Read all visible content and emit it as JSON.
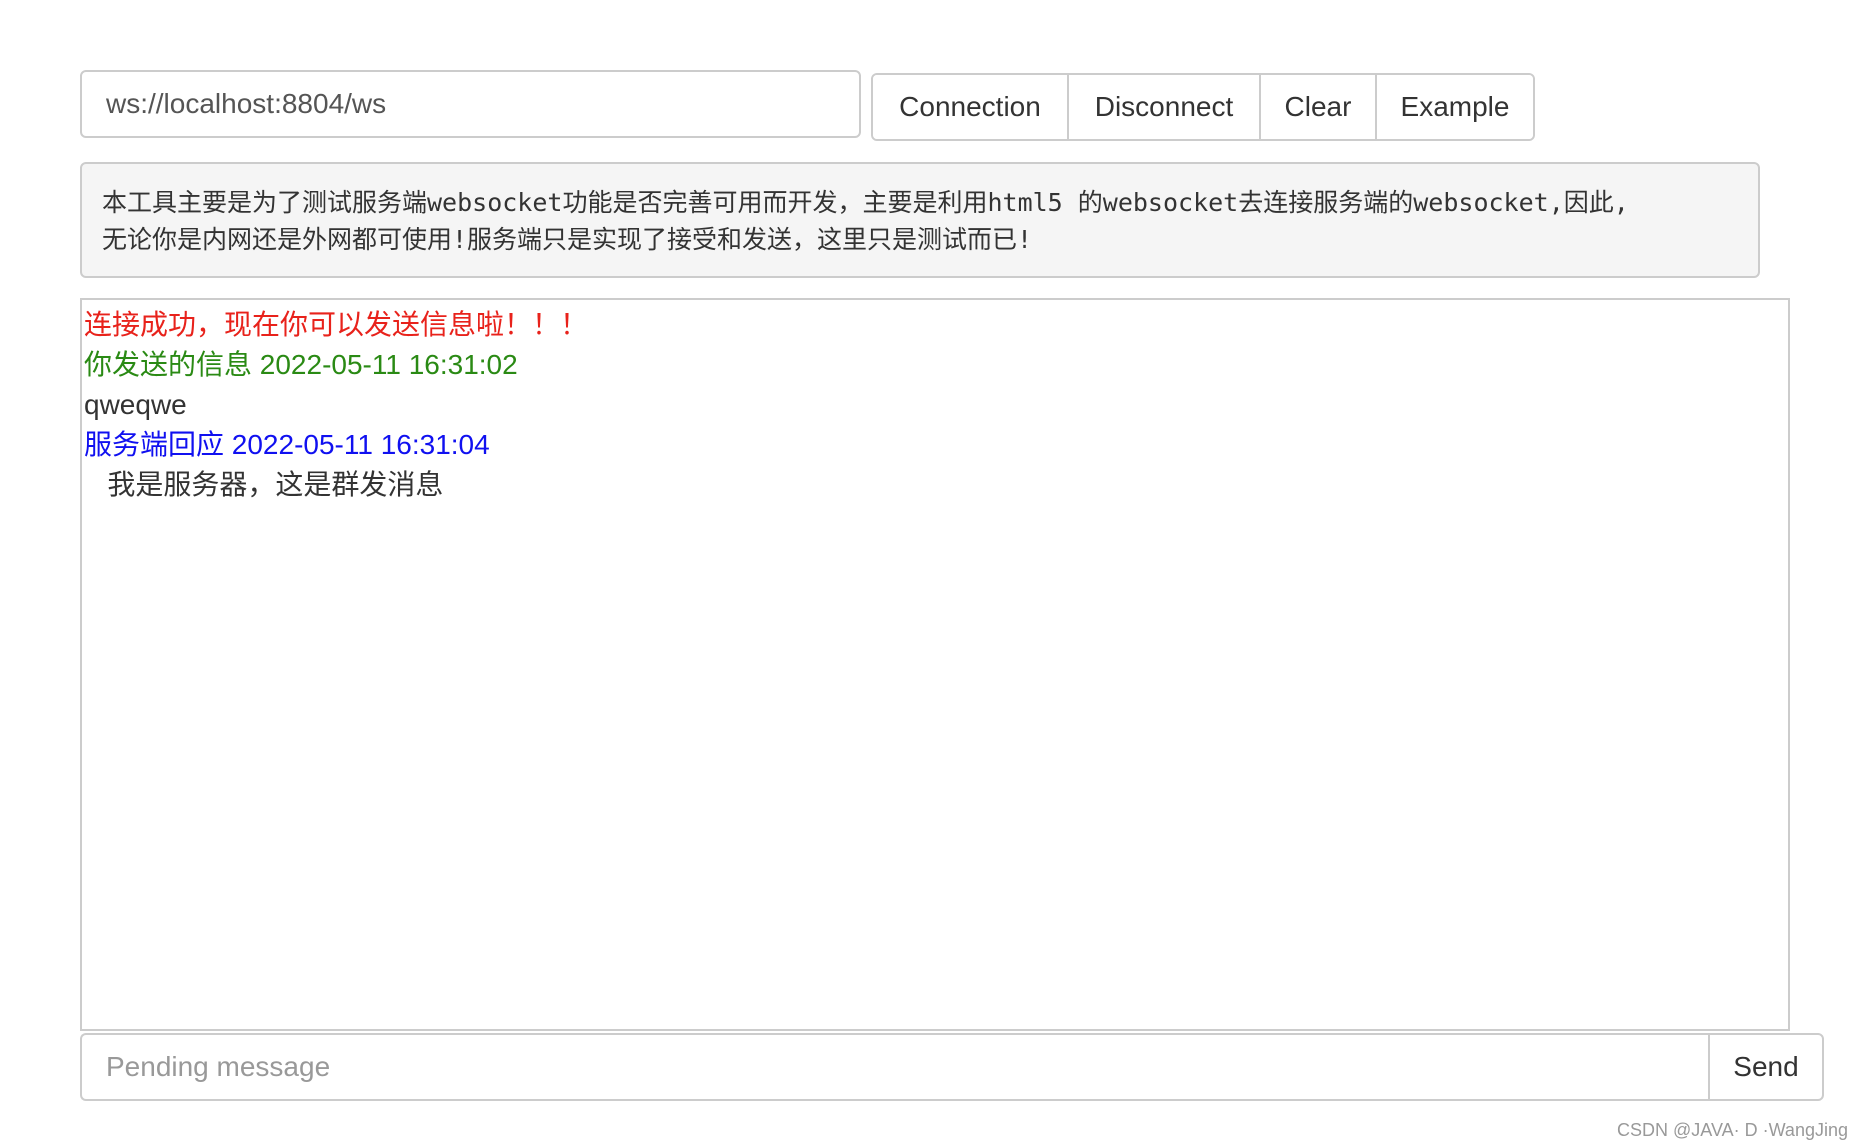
{
  "connection": {
    "url_value": "ws://localhost:8804/ws"
  },
  "toolbar": {
    "connect_label": "Connection",
    "disconnect_label": "Disconnect",
    "clear_label": "Clear",
    "example_label": "Example"
  },
  "notice": {
    "line1": "本工具主要是为了测试服务端websocket功能是否完善可用而开发，主要是利用html5 的websocket去连接服务端的websocket,因此,",
    "line2": "无论你是内网还是外网都可使用!服务端只是实现了接受和发送，这里只是测试而已!"
  },
  "log": {
    "lines": [
      {
        "text": "连接成功，现在你可以发送信息啦！！！",
        "color": "#e8221b"
      },
      {
        "text": "你发送的信息 2022-05-11 16:31:02",
        "color": "#2a8a14"
      },
      {
        "text": "qweqwe",
        "color": "#333333"
      },
      {
        "text": "服务端回应 2022-05-11 16:31:04",
        "color": "#1010f0"
      },
      {
        "text": "   我是服务器，这是群发消息",
        "color": "#333333"
      }
    ]
  },
  "composer": {
    "placeholder": "Pending message",
    "send_label": "Send"
  },
  "watermark": "CSDN @JAVA· D ·WangJing"
}
